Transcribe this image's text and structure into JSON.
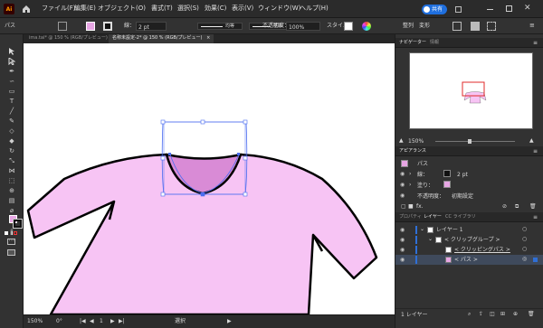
{
  "app": {
    "logo": "Ai",
    "home_icon": "home-icon"
  },
  "menu": [
    "ファイル(F)",
    "編集(E)",
    "オブジェクト(O)",
    "書式(T)",
    "選択(S)",
    "効果(C)",
    "表示(V)",
    "ウィンドウ(W)",
    "ヘルプ(H)"
  ],
  "share_label": "共有",
  "control": {
    "object_type": "パス",
    "stroke_label": "線：",
    "stroke_value": "2 pt",
    "profile_label": "均等",
    "brush_label": "基本",
    "opacity_label": "不透明度：",
    "opacity_value": "100%",
    "style_label": "スタイル：",
    "align_label": "整列",
    "transform_label": "変形"
  },
  "colors": {
    "fill": "#e7a6e4",
    "fill_dark": "#d98bd6",
    "selection": "#4a6cf0",
    "accent_blue": "#2f6fd6"
  },
  "doc_tabs": [
    {
      "label": "ima.tai* @ 150 % (RGB/プレビュー)",
      "close": "×",
      "active": false
    },
    {
      "label": "名称未設定-2* @ 150 % (RGB/プレビュー)",
      "close": "×",
      "active": true
    }
  ],
  "status": {
    "zoom": "150%",
    "rotation": "0°",
    "page": "1",
    "mode": "選択"
  },
  "navigator": {
    "tabs": [
      "ナビゲーター",
      "情報"
    ],
    "zoom": "150%"
  },
  "appearance": {
    "title": "アピアランス",
    "object": "パス",
    "stroke_label": "線：",
    "stroke_value": "2 pt",
    "fill_label": "塗り：",
    "opacity_label": "不透明度：",
    "opacity_value": "初期設定",
    "fx": "fx."
  },
  "layers": {
    "tabs": [
      "プロパティ",
      "レイヤー",
      "CC ライブラリ"
    ],
    "rows": [
      {
        "name": "レイヤー 1",
        "indent": 0
      },
      {
        "name": "< クリップグループ >",
        "indent": 1
      },
      {
        "name": "< クリッピングパス >",
        "indent": 2
      },
      {
        "name": "< パス >",
        "indent": 2
      }
    ],
    "footer": "1 レイヤー"
  },
  "tools": [
    "selection-tool",
    "direct-selection-tool",
    "pen-tool",
    "curvature-tool",
    "rectangle-tool",
    "type-tool",
    "line-tool",
    "paintbrush-tool",
    "shaper-tool",
    "eraser-tool",
    "rotate-tool",
    "scale-tool",
    "width-tool",
    "free-transform-tool",
    "shape-builder-tool",
    "gradient-tool",
    "eyedropper-tool",
    "blend-tool",
    "artboard-tool",
    "hand-tool",
    "zoom-tool"
  ]
}
